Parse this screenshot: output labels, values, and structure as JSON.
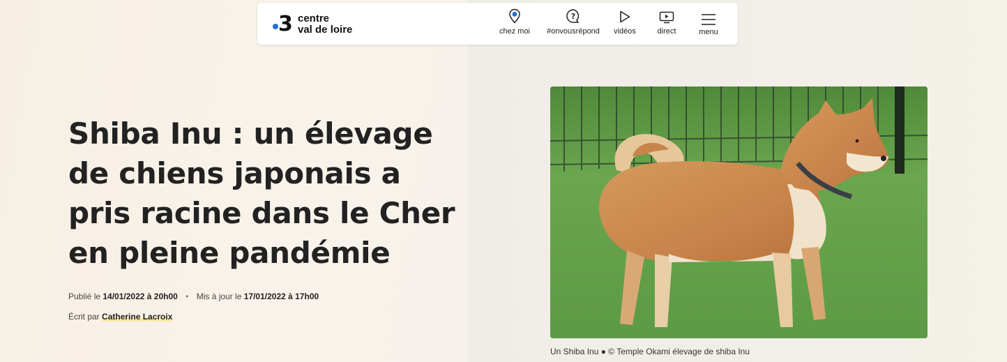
{
  "header": {
    "logo_number": "3",
    "logo_line1": "centre",
    "logo_line2": "val de loire",
    "nav": [
      {
        "label": "chez moi",
        "icon": "location-pin-icon"
      },
      {
        "label": "#onvousrépond",
        "icon": "question-bubble-icon"
      },
      {
        "label": "vidéos",
        "icon": "play-icon"
      },
      {
        "label": "direct",
        "icon": "tv-play-icon"
      },
      {
        "label": "menu",
        "icon": "hamburger-icon"
      }
    ]
  },
  "article": {
    "title": "Shiba Inu : un élevage de chiens japonais a pris racine dans le Cher en pleine pandémie",
    "published_prefix": "Publié le",
    "published_date": "14/01/2022 à 20h00",
    "updated_prefix": "Mis à jour le",
    "updated_date": "17/01/2022 à 17h00",
    "author_prefix": "Écrit par",
    "author": "Catherine Lacroix",
    "separator": "•",
    "image_caption": "Un Shiba Inu ● © Temple Okami élevage de shiba Inu"
  },
  "colors": {
    "accent_blue": "#1f6fd6",
    "author_highlight": "#fbe7a4"
  }
}
